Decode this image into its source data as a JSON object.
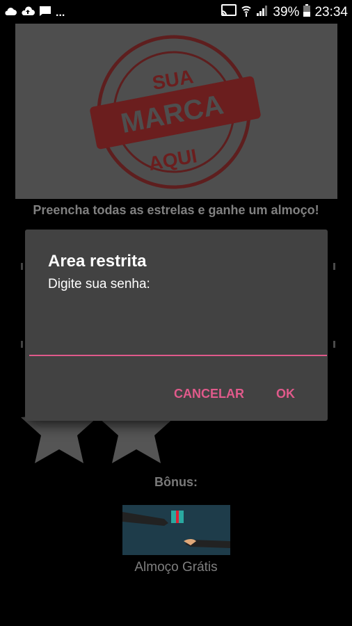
{
  "status_bar": {
    "left_icons": [
      "cloud-icon",
      "cloud-upload-icon",
      "chat-icon"
    ],
    "overflow": "...",
    "battery": "39%",
    "time": "23:34"
  },
  "brand_stamp": {
    "top": "SUA",
    "middle": "MARCA",
    "bottom": "AQUI"
  },
  "tagline": "Preencha todas as estrelas e ganhe um almoço!",
  "bonus": {
    "label": "Bônus:",
    "caption": "Almoço Grátis"
  },
  "dialog": {
    "title": "Area restrita",
    "message": "Digite sua senha:",
    "password_value": "",
    "cancel_label": "CANCELAR",
    "ok_label": "OK"
  },
  "colors": {
    "accent": "#e05a8b",
    "dialog_bg": "#424242",
    "stamp": "#6b1e1e"
  }
}
